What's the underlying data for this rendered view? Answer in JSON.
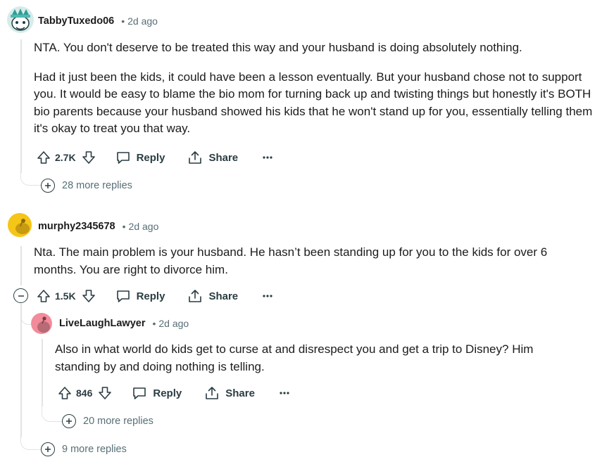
{
  "comments": [
    {
      "username": "TabbyTuxedo06",
      "time": "2d ago",
      "paragraphs": [
        "NTA. You don't deserve to be treated this way and your husband is doing absolutely nothing.",
        "Had it just been the kids, it could have been a lesson eventually. But your husband chose not to support you. It would be easy to blame the bio mom for turning back up and twisting things but honestly it's BOTH bio parents because your husband showed his kids that he won't stand up for you, essentially telling them it's okay to treat you that way."
      ],
      "votes": "2.7K",
      "reply_label": "Reply",
      "share_label": "Share",
      "more_replies": "28 more replies"
    },
    {
      "username": "murphy2345678",
      "time": "2d ago",
      "paragraphs": [
        "Nta. The main problem is your husband. He hasn’t been standing up for you to the kids for over 6 months. You are right to divorce him."
      ],
      "votes": "1.5K",
      "reply_label": "Reply",
      "share_label": "Share",
      "more_replies": "9 more replies"
    },
    {
      "username": "LiveLaughLawyer",
      "time": "2d ago",
      "paragraphs": [
        "Also in what world do kids get to curse at and disrespect you and get a trip to Disney? Him standing by and doing nothing is telling."
      ],
      "votes": "846",
      "reply_label": "Reply",
      "share_label": "Share",
      "more_replies": "20 more replies"
    }
  ],
  "separator": "•",
  "icons": {
    "upvote": "upvote-arrow-icon",
    "downvote": "downvote-arrow-icon",
    "reply": "comment-bubble-icon",
    "share": "share-upload-icon",
    "overflow": "ellipsis-icon",
    "expand": "plus-circle-icon",
    "collapse": "minus-circle-icon"
  },
  "colors": {
    "text": "#1c1c1c",
    "meta": "#576f76",
    "thread_line": "#e0e4e6",
    "avatar1_bg": "#4fb8b0",
    "avatar2_bg": "#f5c518",
    "avatar3_bg": "#f28b9a"
  }
}
